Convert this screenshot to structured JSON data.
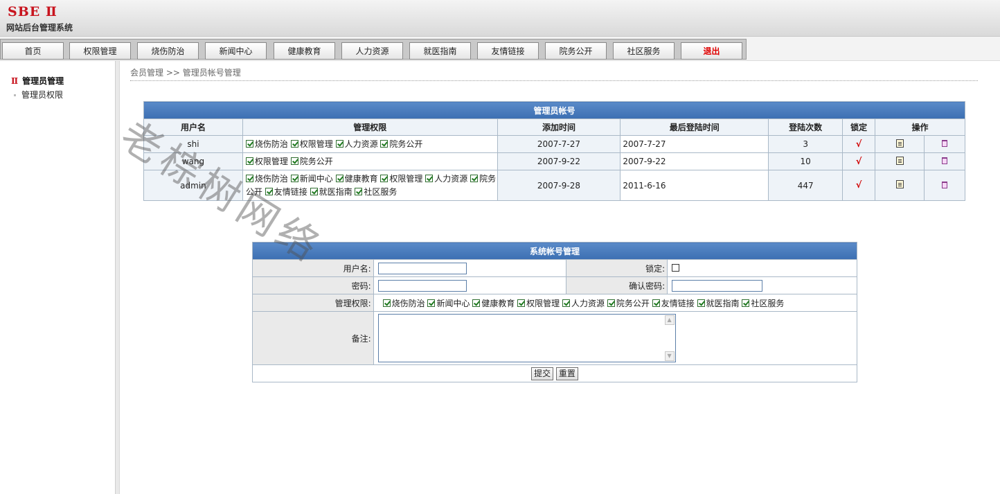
{
  "header": {
    "logo": "SBE Ⅱ",
    "subtitle": "网站后台管理系统"
  },
  "nav": [
    "首页",
    "权限管理",
    "烧伤防治",
    "新闻中心",
    "健康教育",
    "人力资源",
    "就医指南",
    "友情链接",
    "院务公开",
    "社区服务",
    "退出"
  ],
  "sidebar": {
    "heading": "管理员管理",
    "heading_mark": "Ⅱ",
    "items": [
      "管理员权限"
    ]
  },
  "breadcrumb": "会员管理 >> 管理员帐号管理",
  "accounts_table": {
    "caption": "管理员帐号",
    "headers": [
      "用户名",
      "管理权限",
      "添加时间",
      "最后登陆时间",
      "登陆次数",
      "锁定",
      "操作"
    ],
    "rows": [
      {
        "user": "shi",
        "perms": [
          "烧伤防治",
          "权限管理",
          "人力资源",
          "院务公开"
        ],
        "added": "2007-7-27",
        "last": "2007-7-27",
        "count": "3"
      },
      {
        "user": "wang",
        "perms": [
          "权限管理",
          "院务公开"
        ],
        "added": "2007-9-22",
        "last": "2007-9-22",
        "count": "10"
      },
      {
        "user": "admin",
        "perms": [
          "烧伤防治",
          "新闻中心",
          "健康教育",
          "权限管理",
          "人力资源",
          "院务公开",
          "友情链接",
          "就医指南",
          "社区服务"
        ],
        "added": "2007-9-28",
        "last": "2011-6-16",
        "count": "447"
      }
    ],
    "lock_mark": "√"
  },
  "form": {
    "caption": "系统帐号管理",
    "username_label": "用户名:",
    "lock_label": "锁定:",
    "password_label": "密码:",
    "confirm_label": "确认密码:",
    "perms_label": "管理权限:",
    "perms": [
      "烧伤防治",
      "新闻中心",
      "健康教育",
      "权限管理",
      "人力资源",
      "院务公开",
      "友情链接",
      "就医指南",
      "社区服务"
    ],
    "remark_label": "备注:",
    "submit": "提交",
    "reset": "重置"
  },
  "watermark": "老棕树网络",
  "colors": {
    "accent_blue": "#3c6fb2",
    "logout_red": "#e00000",
    "logo_red": "#c8141e"
  },
  "icons": {
    "edit": "edit-icon",
    "delete": "trash-icon"
  }
}
